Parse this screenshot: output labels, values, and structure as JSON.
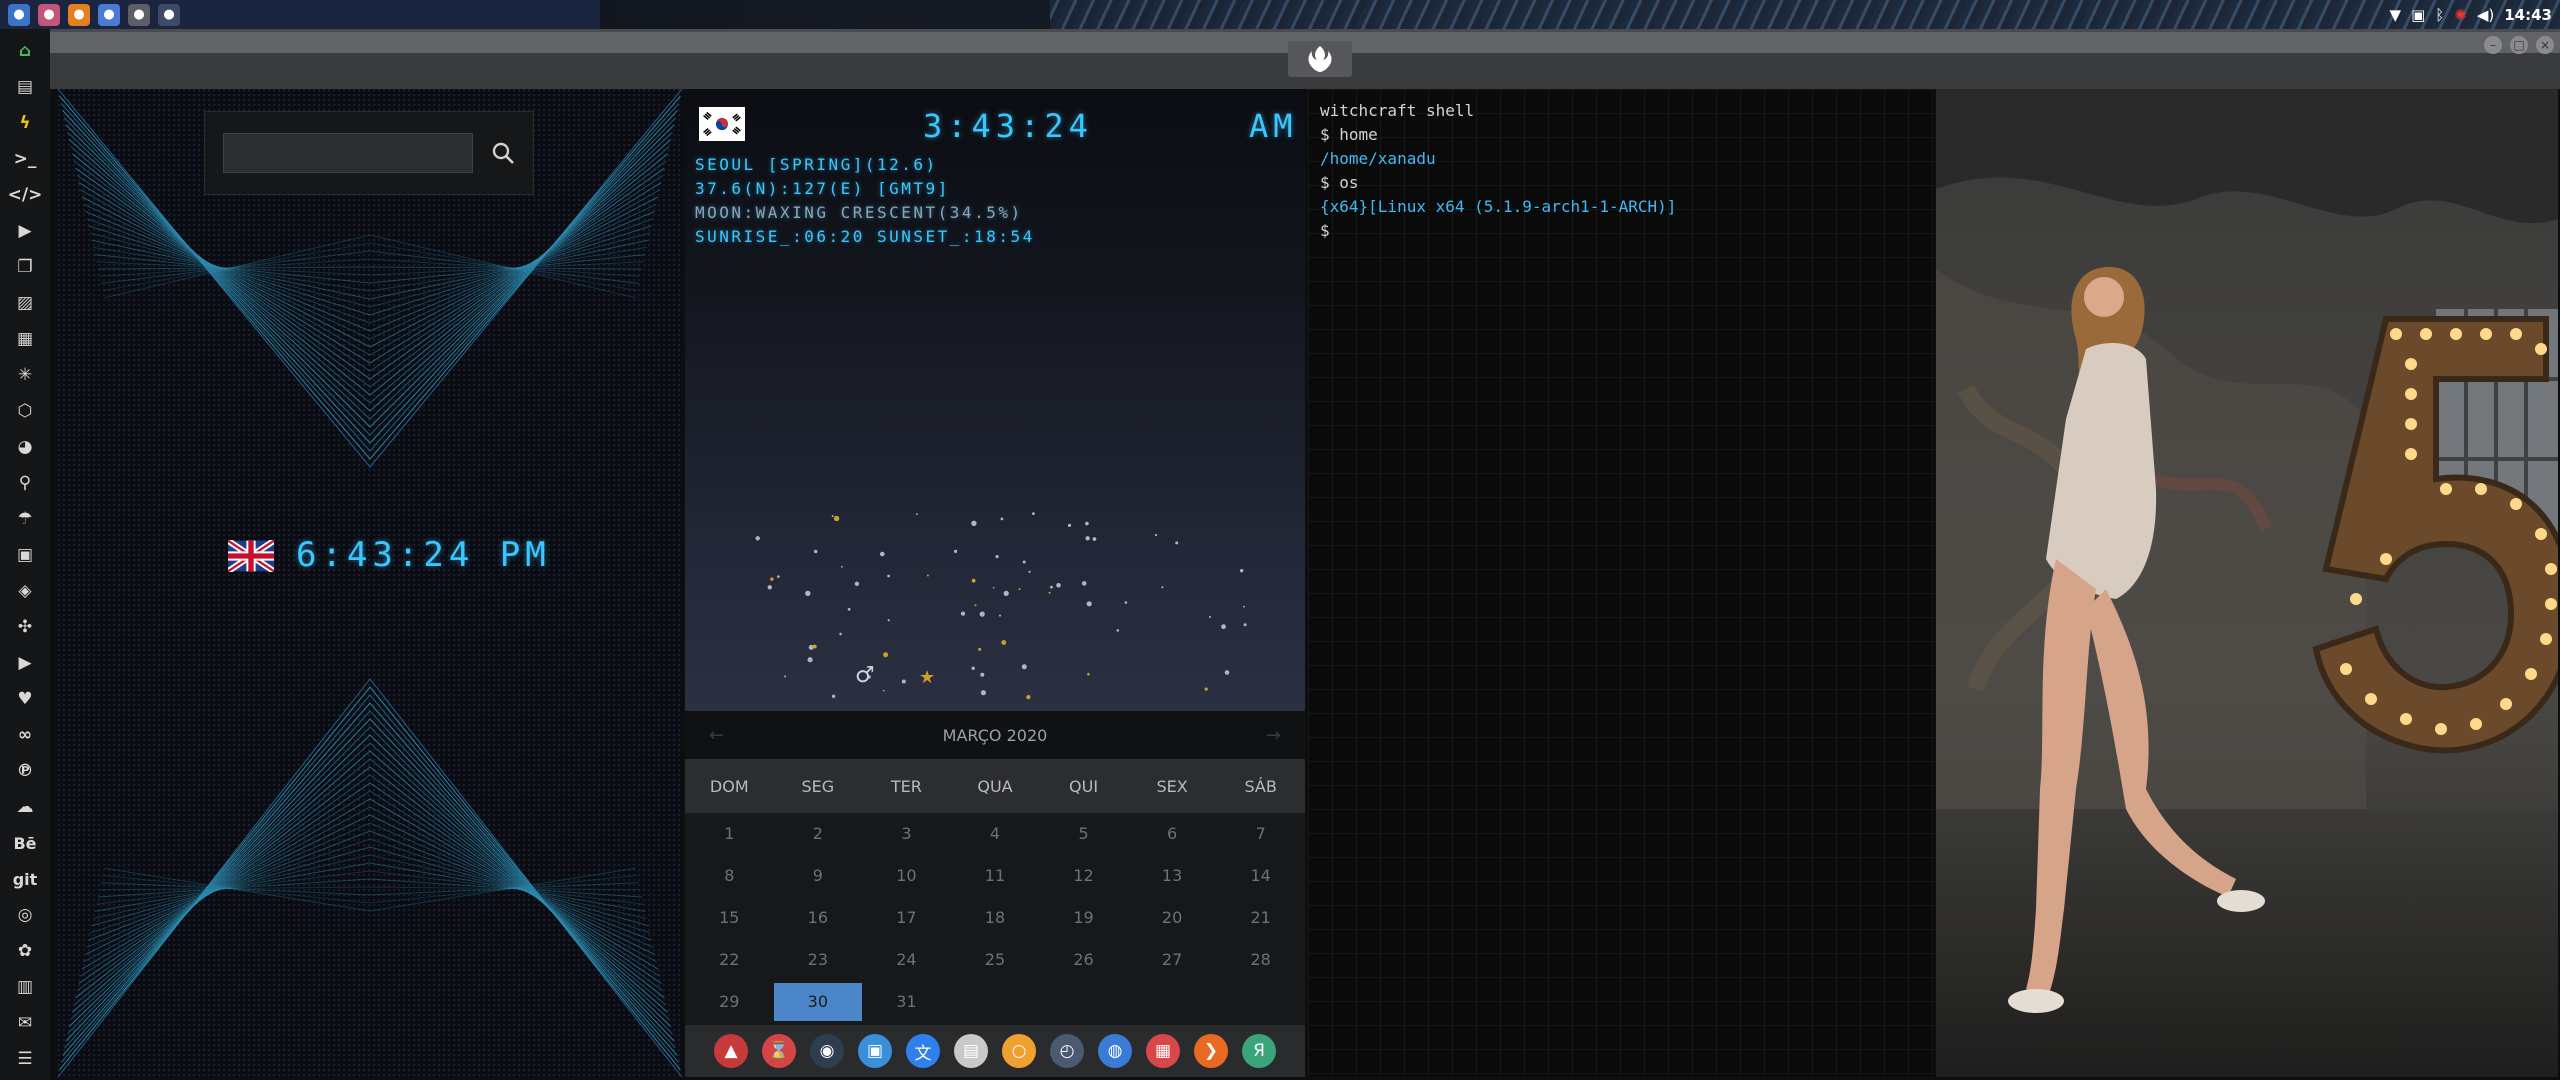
{
  "topbar": {
    "clock": "14:43",
    "launchers": [
      {
        "name": "files-icon",
        "color": "#3b73c8"
      },
      {
        "name": "heart-app-icon",
        "color": "#c2557a"
      },
      {
        "name": "sublime-icon",
        "color": "#e67e22"
      },
      {
        "name": "chromium-icon",
        "color": "#4a7bd4"
      },
      {
        "name": "se-icon",
        "color": "#5c5f66"
      },
      {
        "name": "window-icon",
        "color": "#3d4b66"
      }
    ]
  },
  "dock": {
    "items": [
      "home-icon",
      "document-icon",
      "bolt-icon",
      "terminal-icon",
      "code-icon",
      "play-icon",
      "docs-icon",
      "image-icon",
      "news-icon",
      "asterisk-icon",
      "hexagon-icon",
      "globe-icon",
      "search-icon",
      "umbrella-icon",
      "contacts-icon",
      "tag-icon",
      "expand-icon",
      "youtube-icon",
      "heart-icon",
      "infinity-icon",
      "pinterest-icon",
      "cloud-icon",
      "behance-icon",
      "git-icon",
      "github-icon",
      "group-icon",
      "map-icon",
      "mail-icon",
      "list-icon"
    ],
    "behance_label": "Bē",
    "git_label": "git"
  },
  "uk_clock": {
    "time": "6:43:24 PM"
  },
  "search": {
    "placeholder": ""
  },
  "seoul": {
    "time": "3:43:24",
    "ampm": "AM",
    "line1": "SEOUL [SPRING](12.6)",
    "line2": "37.6(N):127(E) [GMT9]",
    "line3_label": "MOON:",
    "line3_value": "WAXING CRESCENT(34.5%)",
    "line4": "SUNRISE_:06:20 SUNSET_:18:54",
    "mars_symbol": "♂",
    "sun_symbol": "★"
  },
  "calendar": {
    "title": "MARÇO 2020",
    "prev": "←",
    "next": "→",
    "weekdays": [
      "DOM",
      "SEG",
      "TER",
      "QUA",
      "QUI",
      "SEX",
      "SÁB"
    ],
    "days": [
      "1",
      "2",
      "3",
      "4",
      "5",
      "6",
      "7",
      "8",
      "9",
      "10",
      "11",
      "12",
      "13",
      "14",
      "15",
      "16",
      "17",
      "18",
      "19",
      "20",
      "21",
      "22",
      "23",
      "24",
      "25",
      "26",
      "27",
      "28",
      "29",
      "30",
      "31"
    ],
    "today": "30"
  },
  "apps": [
    {
      "name": "red-triangle-app-icon",
      "color": "#c63a3a",
      "glyph": "▲"
    },
    {
      "name": "hourglass-app-icon",
      "color": "#d64545",
      "glyph": "⌛"
    },
    {
      "name": "earth-app-icon",
      "color": "#2c3e50",
      "glyph": "◉"
    },
    {
      "name": "image-viewer-app-icon",
      "color": "#3a8fd8",
      "glyph": "▣"
    },
    {
      "name": "translate-app-icon",
      "color": "#2f80ed",
      "glyph": "文"
    },
    {
      "name": "news-app-icon",
      "color": "#c9c9c9",
      "glyph": "▤"
    },
    {
      "name": "search-app-icon",
      "color": "#f0a030",
      "glyph": "○"
    },
    {
      "name": "clock-app-icon",
      "color": "#4a5a70",
      "glyph": "◴"
    },
    {
      "name": "web-app-icon",
      "color": "#3a7bd5",
      "glyph": "◍"
    },
    {
      "name": "calendar-app-icon",
      "color": "#d94848",
      "glyph": "▦"
    },
    {
      "name": "arrow-app-icon",
      "color": "#e86a20",
      "glyph": "❯"
    },
    {
      "name": "yandex-app-icon",
      "color": "#3aa57a",
      "glyph": "Я"
    }
  ],
  "terminal": {
    "title": "witchcraft shell",
    "prompt1": "$ home",
    "output1": "/home/xanadu",
    "prompt2": "$ os",
    "output2": "{x64}[Linux x64 (5.1.9-arch1-1-ARCH)]",
    "prompt3": "$"
  },
  "photo": {
    "numeral": "5"
  },
  "colors": {
    "accent_cyan": "#3ac7ff",
    "calendar_today": "#4a86c8",
    "terminal_blue": "#3fb9f5"
  }
}
